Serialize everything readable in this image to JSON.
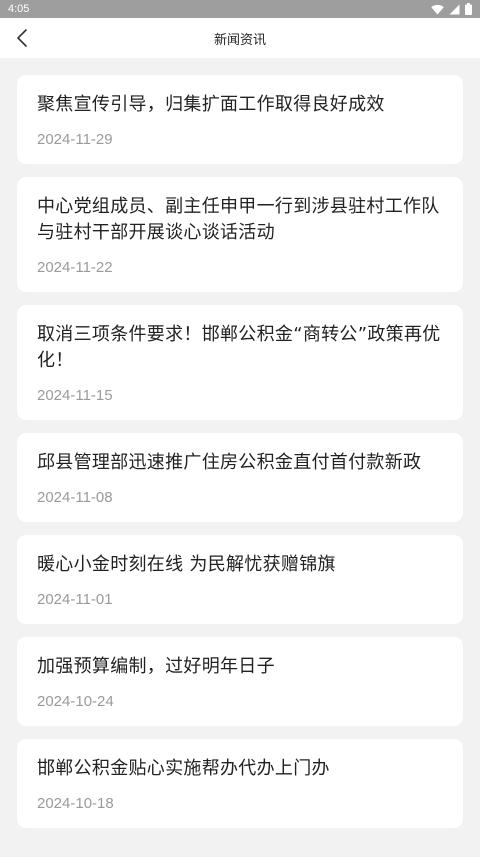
{
  "status_bar": {
    "time": "4:05",
    "icons": [
      "wifi-icon",
      "signal-icon",
      "battery-icon"
    ]
  },
  "app_bar": {
    "title": "新闻资讯",
    "back_icon": "chevron-left-icon"
  },
  "news": [
    {
      "title": "聚焦宣传引导，归集扩面工作取得良好成效",
      "date": "2024-11-29"
    },
    {
      "title": "中心党组成员、副主任申甲一行到涉县驻村工作队与驻村干部开展谈心谈话活动",
      "date": "2024-11-22"
    },
    {
      "title": "取消三项条件要求！邯郸公积金“商转公”政策再优化！",
      "date": "2024-11-15"
    },
    {
      "title": "邱县管理部迅速推广住房公积金直付首付款新政",
      "date": "2024-11-08"
    },
    {
      "title": "暖心小金时刻在线 为民解忧获赠锦旗",
      "date": "2024-11-01"
    },
    {
      "title": "加强预算编制，过好明年日子",
      "date": "2024-10-24"
    },
    {
      "title": "邯郸公积金贴心实施帮办代办上门办",
      "date": "2024-10-18"
    }
  ],
  "colors": {
    "status_bar_bg": "#9e9e9e",
    "page_bg": "#f2f2f2",
    "card_bg": "#ffffff",
    "title_text": "#222222",
    "date_text": "#9a9a9a"
  }
}
